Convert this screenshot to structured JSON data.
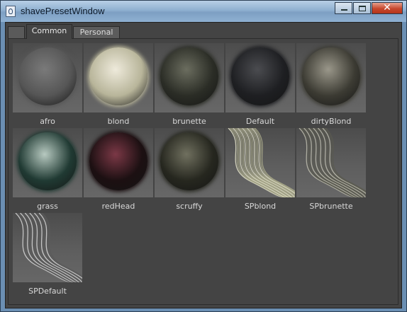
{
  "window": {
    "title": "shavePresetWindow"
  },
  "tabs": [
    {
      "label": "Common",
      "active": true
    },
    {
      "label": "Personal",
      "active": false
    }
  ],
  "presets": [
    {
      "label": "afro",
      "kind": "ball",
      "color": "#565656",
      "hi": "#7a7a7a"
    },
    {
      "label": "blond",
      "kind": "ball",
      "color": "#b8b59a",
      "hi": "#eeeadb"
    },
    {
      "label": "brunette",
      "kind": "ball",
      "color": "#2b2d26",
      "hi": "#6b6d5f"
    },
    {
      "label": "Default",
      "kind": "ball",
      "color": "#1e1f22",
      "hi": "#4b4c50"
    },
    {
      "label": "dirtyBlond",
      "kind": "ball",
      "color": "#3c3b33",
      "hi": "#9a978a"
    },
    {
      "label": "grass",
      "kind": "ball",
      "color": "#203a33",
      "hi": "#b7c9c0"
    },
    {
      "label": "redHead",
      "kind": "ball",
      "color": "#1c1012",
      "hi": "#7b3846"
    },
    {
      "label": "scruffy",
      "kind": "ball",
      "color": "#26271f",
      "hi": "#70705f"
    },
    {
      "label": "SPblond",
      "kind": "strand",
      "color": "#a9a98a",
      "hi": "#e7e6cd"
    },
    {
      "label": "SPbrunette",
      "kind": "strand",
      "color": "#5a5b50",
      "hi": "#bdbcad"
    },
    {
      "label": "SPDefault",
      "kind": "strand",
      "color": "#5b5b5b",
      "hi": "#d8d8d8"
    }
  ]
}
